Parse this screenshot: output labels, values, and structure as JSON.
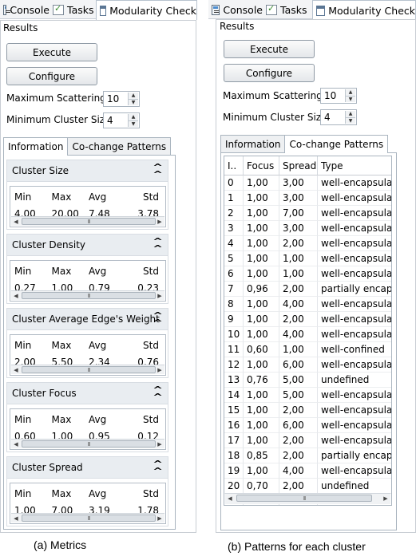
{
  "tabs": {
    "console": "Console",
    "tasks": "Tasks",
    "modularity": "Modularity Check"
  },
  "left": {
    "results_label": "Results",
    "execute": "Execute",
    "configure": "Configure",
    "max_scattering_label": "Maximum Scattering",
    "max_scattering_value": "10",
    "min_cluster_label": "Minimum Cluster Size",
    "min_cluster_value": "4",
    "tab_information": "Information",
    "tab_cochange": "Co-change Patterns",
    "sections": [
      {
        "title": "Cluster Size",
        "headers": [
          "Min",
          "Max",
          "Avg",
          "Std"
        ],
        "values": [
          "4,00",
          "20,00",
          "7,48",
          "3,78"
        ]
      },
      {
        "title": "Cluster Density",
        "headers": [
          "Min",
          "Max",
          "Avg",
          "Std"
        ],
        "values": [
          "0,27",
          "1,00",
          "0,79",
          "0,23"
        ]
      },
      {
        "title": "Cluster Average Edge's Weight",
        "headers": [
          "Min",
          "Max",
          "Avg",
          "Std"
        ],
        "values": [
          "2,00",
          "5,50",
          "2,34",
          "0,76"
        ]
      },
      {
        "title": "Cluster Focus",
        "headers": [
          "Min",
          "Max",
          "Avg",
          "Std"
        ],
        "values": [
          "0,60",
          "1,00",
          "0,95",
          "0,12"
        ]
      },
      {
        "title": "Cluster Spread",
        "headers": [
          "Min",
          "Max",
          "Avg",
          "Std"
        ],
        "values": [
          "1,00",
          "7,00",
          "3,19",
          "1,78"
        ]
      }
    ],
    "caption": "(a) Metrics"
  },
  "right": {
    "results_label": "Results",
    "execute": "Execute",
    "configure": "Configure",
    "max_scattering_label": "Maximum Scattering",
    "max_scattering_value": "10",
    "min_cluster_label": "Minimum Cluster Size",
    "min_cluster_value": "4",
    "tab_information": "Information",
    "tab_cochange": "Co-change Patterns",
    "columns": [
      "I..",
      "Focus",
      "Spread",
      "Type"
    ],
    "rows": [
      [
        "0",
        "1,00",
        "3,00",
        "well-encapsulate"
      ],
      [
        "1",
        "1,00",
        "3,00",
        "well-encapsulate"
      ],
      [
        "2",
        "1,00",
        "7,00",
        "well-encapsulate"
      ],
      [
        "3",
        "1,00",
        "3,00",
        "well-encapsulate"
      ],
      [
        "4",
        "1,00",
        "2,00",
        "well-encapsulate"
      ],
      [
        "5",
        "1,00",
        "1,00",
        "well-encapsulate"
      ],
      [
        "6",
        "1,00",
        "1,00",
        "well-encapsulate"
      ],
      [
        "7",
        "0,96",
        "2,00",
        "partially encapsu"
      ],
      [
        "8",
        "1,00",
        "4,00",
        "well-encapsulate"
      ],
      [
        "9",
        "1,00",
        "2,00",
        "well-encapsulate"
      ],
      [
        "10",
        "1,00",
        "4,00",
        "well-encapsulate"
      ],
      [
        "11",
        "0,60",
        "1,00",
        "well-confined"
      ],
      [
        "12",
        "1,00",
        "6,00",
        "well-encapsulate"
      ],
      [
        "13",
        "0,76",
        "5,00",
        "undefined"
      ],
      [
        "14",
        "1,00",
        "5,00",
        "well-encapsulate"
      ],
      [
        "15",
        "1,00",
        "2,00",
        "well-encapsulate"
      ],
      [
        "16",
        "1,00",
        "6,00",
        "well-encapsulate"
      ],
      [
        "17",
        "1,00",
        "2,00",
        "well-encapsulate"
      ],
      [
        "18",
        "0,85",
        "2,00",
        "partially encapsu"
      ],
      [
        "19",
        "1,00",
        "4,00",
        "well-encapsulate"
      ],
      [
        "20",
        "0,70",
        "2,00",
        "undefined"
      ]
    ],
    "caption": "(b) Patterns for each cluster"
  }
}
